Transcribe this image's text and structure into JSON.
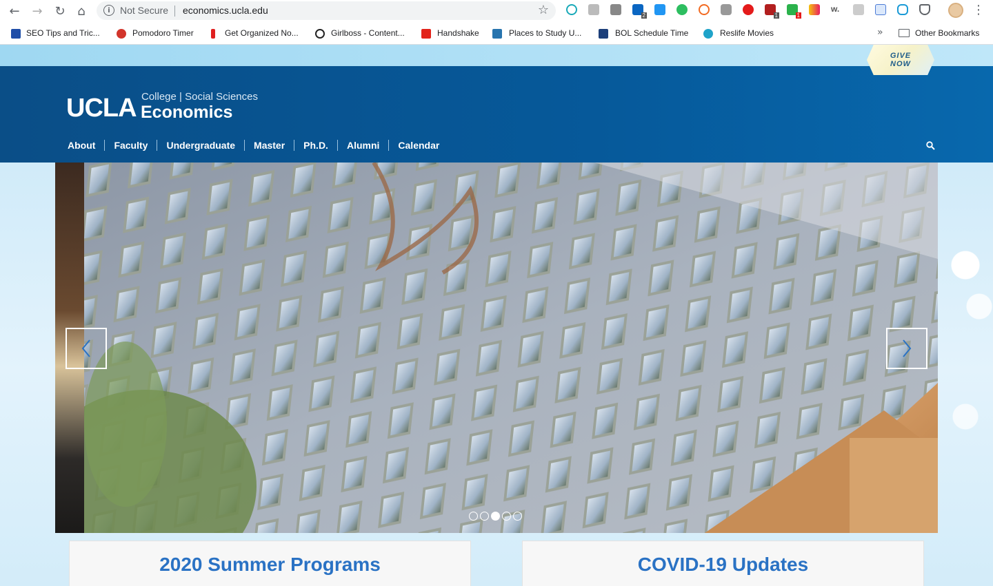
{
  "browser": {
    "security_label": "Not Secure",
    "url": "economics.ucla.edu",
    "extension_badges": [
      "2",
      "1",
      "1"
    ]
  },
  "bookmarks": {
    "items": [
      {
        "label": "SEO Tips and Tric...",
        "icon": "ahrefs-icon",
        "color": "#1f4ea8"
      },
      {
        "label": "Pomodoro Timer",
        "icon": "tomato-icon",
        "color": "#d2352b"
      },
      {
        "label": "Get Organized No...",
        "icon": "stripes-icon",
        "color": "#e02020"
      },
      {
        "label": "Girlboss - Content...",
        "icon": "girlboss-icon",
        "color": "#222222"
      },
      {
        "label": "Handshake",
        "icon": "handshake-icon",
        "color": "#e2231a"
      },
      {
        "label": "Places to Study U...",
        "icon": "ucla-icon",
        "color": "#2774ae"
      },
      {
        "label": "BOL Schedule Time",
        "icon": "bol-icon",
        "color": "#1c3f7a"
      },
      {
        "label": "Reslife Movies",
        "icon": "film-reel-icon",
        "color": "#1fa3c9"
      }
    ],
    "more": "»",
    "other": "Other Bookmarks"
  },
  "site": {
    "give_line1": "GIVE",
    "give_line2": "NOW",
    "logo_ucla": "UCLA",
    "logo_college": "College | Social Sciences",
    "logo_dept": "Economics",
    "nav": [
      "About",
      "Faculty",
      "Undergraduate",
      "Master",
      "Ph.D.",
      "Alumni",
      "Calendar"
    ]
  },
  "carousel": {
    "slide_count": 5,
    "active_index": 2
  },
  "cards": [
    {
      "title": "2020 Summer Programs"
    },
    {
      "title": "COVID-19 Updates"
    }
  ],
  "colors": {
    "header": "#06599a",
    "card_title": "#2a72c4",
    "accent_strip": "#9fd8f2"
  }
}
